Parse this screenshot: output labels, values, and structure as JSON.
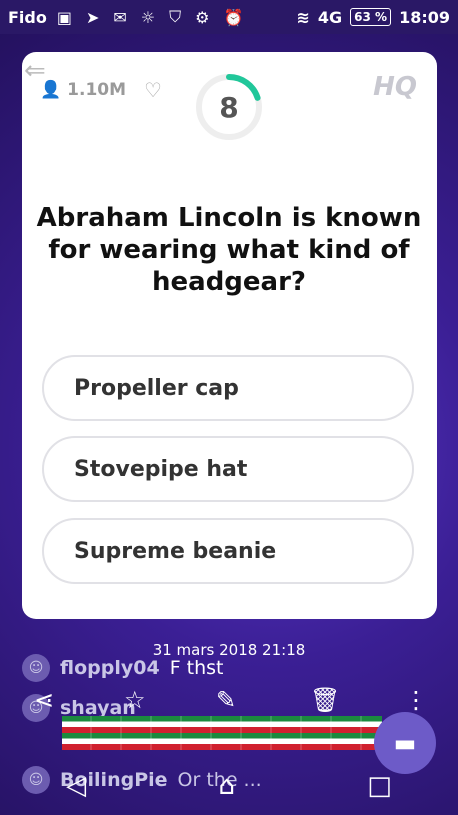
{
  "statusbar": {
    "carrier": "Fido",
    "battery": "63 %",
    "time": "18:09",
    "network": "4G"
  },
  "game": {
    "logo": "HQ",
    "viewers": "1.10M",
    "timer": "8",
    "timer_progress": 0.2,
    "question": "Abraham Lincoln is known for wearing what kind of headgear?",
    "answers": [
      "Propeller cap",
      "Stovepipe hat",
      "Supreme beanie"
    ]
  },
  "screenshot_date": "31 mars 2018 21:18",
  "chat": [
    {
      "name": "flopply04",
      "message": "F thst"
    },
    {
      "name": "shayan",
      "message": ""
    },
    {
      "name": "BoilingPie",
      "message": "Or the ..."
    }
  ],
  "colors": {
    "accent_green": "#21c79a",
    "background": "#3b1f95"
  }
}
